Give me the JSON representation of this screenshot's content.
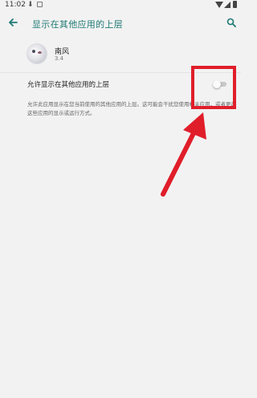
{
  "status_bar": {
    "time": "11:02",
    "download_glyph": "⬇"
  },
  "header": {
    "title": "显示在其他应用的上层"
  },
  "app": {
    "name": "南风",
    "version": "3.4"
  },
  "permission": {
    "label": "允许显示在其他应用的上层",
    "enabled": false,
    "description": "允许此应用显示在您当前使用的其他应用的上层。这可能会干扰您使用相关应用，或者更改这些应用的显示或运行方式。"
  },
  "annotation": {
    "color": "#e01e2a"
  },
  "colors": {
    "accent": "#1f7a74",
    "background": "#f2f2f2"
  },
  "icons": [
    "back-arrow-icon",
    "search-icon",
    "download-icon",
    "image-icon",
    "wifi-icon",
    "signal-icon",
    "battery-icon"
  ]
}
